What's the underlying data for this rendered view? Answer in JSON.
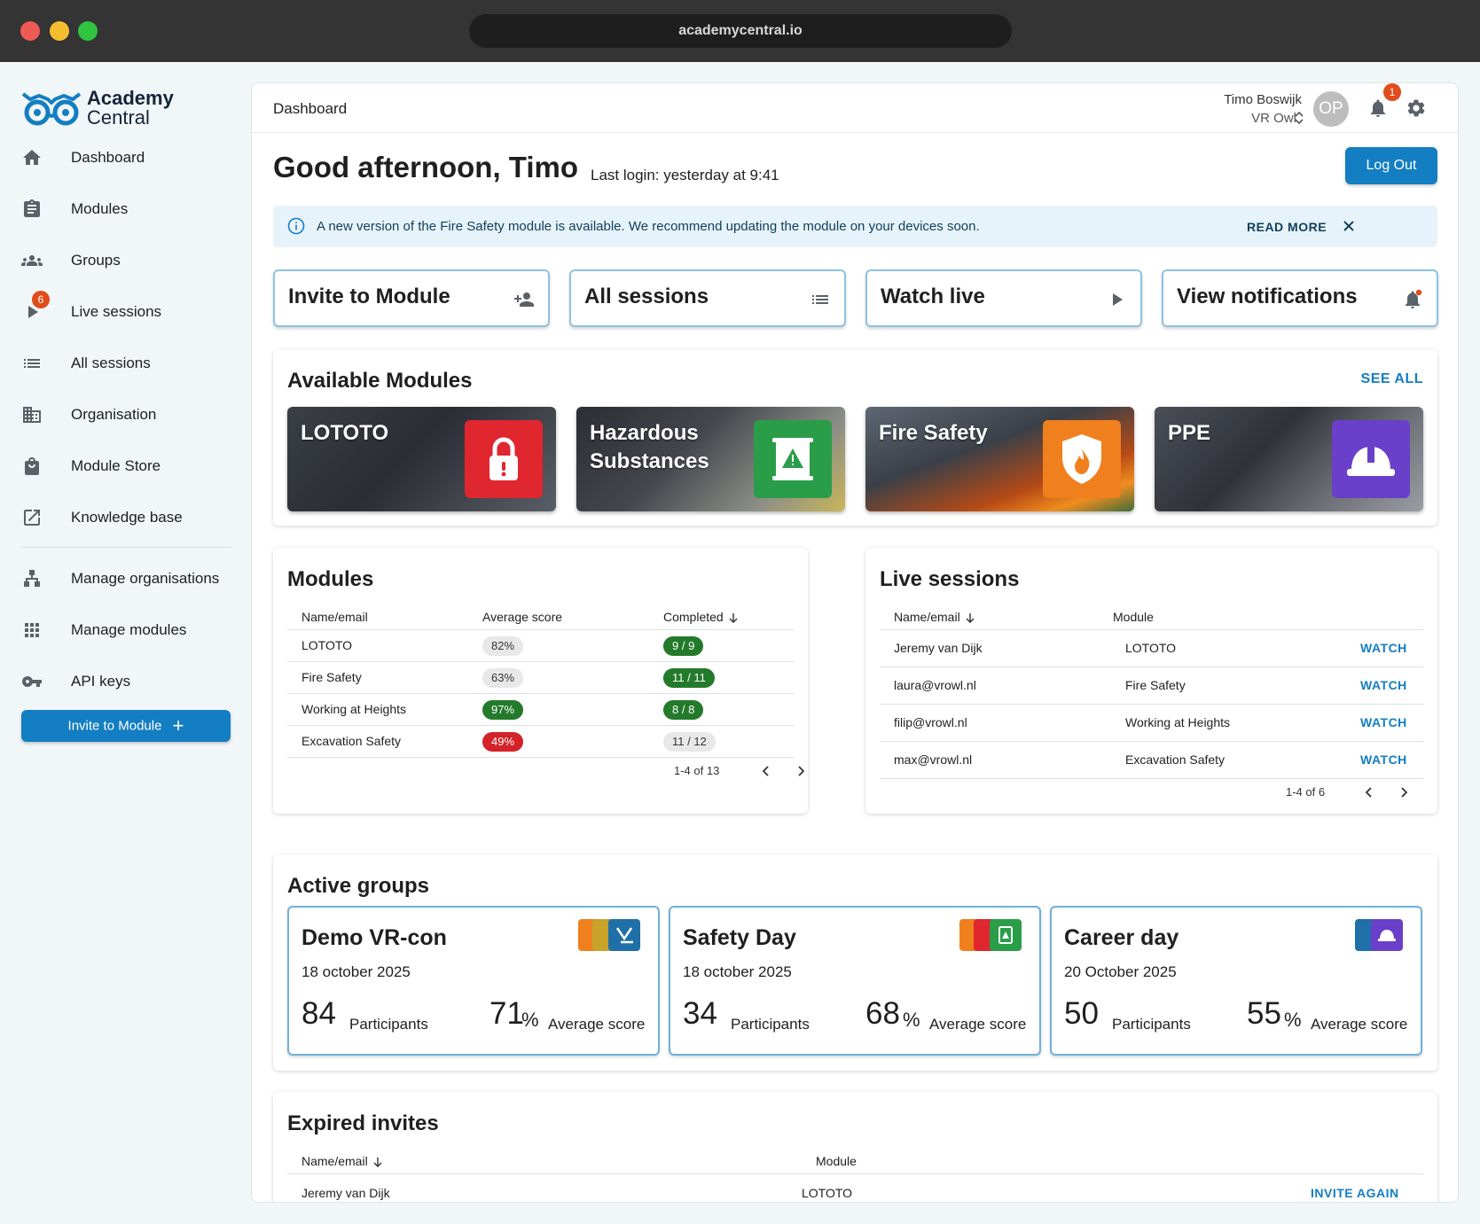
{
  "browser": {
    "url": "academycentral.io"
  },
  "brand": {
    "line1": "Academy",
    "line2": "Central"
  },
  "sidebar": {
    "items": [
      {
        "label": "Dashboard",
        "icon": "home-icon"
      },
      {
        "label": "Modules",
        "icon": "clipboard-icon"
      },
      {
        "label": "Groups",
        "icon": "groups-icon"
      },
      {
        "label": "Live sessions",
        "icon": "play-icon",
        "badge": "6"
      },
      {
        "label": "All sessions",
        "icon": "list-icon"
      },
      {
        "label": "Organisation",
        "icon": "building-icon"
      },
      {
        "label": "Module Store",
        "icon": "shopping-bag-icon"
      },
      {
        "label": "Knowledge base",
        "icon": "external-link-icon"
      },
      {
        "label": "Manage organisations",
        "icon": "hierarchy-icon"
      },
      {
        "label": "Manage modules",
        "icon": "apps-grid-icon"
      },
      {
        "label": "API keys",
        "icon": "key-icon"
      }
    ],
    "invite_label": "Invite to Module",
    "invite_icon": "+"
  },
  "header": {
    "breadcrumb": "Dashboard",
    "user_name": "Timo Boswijk",
    "user_org": "VR Owl",
    "avatar_initials": "OP",
    "notification_count": "1"
  },
  "main": {
    "greeting": "Good afternoon, Timo",
    "last_login": "Last login: yesterday at 9:41",
    "logout_label": "Log Out",
    "alert": {
      "text": "A new version of the Fire Safety module is available. We recommend updating the module on your devices soon.",
      "action": "READ MORE"
    },
    "quick_actions": [
      {
        "label": "Invite to Module",
        "icon": "person-add-icon"
      },
      {
        "label": "All sessions",
        "icon": "list-icon"
      },
      {
        "label": "Watch live",
        "icon": "play-icon"
      },
      {
        "label": "View notifications",
        "icon": "bell-dot-icon"
      }
    ],
    "available_modules": {
      "title": "Available Modules",
      "see_all": "SEE ALL",
      "items": [
        {
          "name": "LOTOTO",
          "icon": "lock-icon",
          "color": "#e0262f"
        },
        {
          "name": "Hazardous Substances",
          "icon": "hazard-barrel-icon",
          "color": "#2a9d48"
        },
        {
          "name": "Fire Safety",
          "icon": "fire-shield-icon",
          "color": "#f07f1e"
        },
        {
          "name": "PPE",
          "icon": "hardhat-icon",
          "color": "#6a3fc9"
        }
      ]
    },
    "modules_table": {
      "title": "Modules",
      "columns": [
        "Name/email",
        "Average score",
        "Completed"
      ],
      "rows": [
        {
          "name": "LOTOTO",
          "score": "82%",
          "score_style": "grey",
          "completed": "9 / 9",
          "completed_style": "green"
        },
        {
          "name": "Fire Safety",
          "score": "63%",
          "score_style": "grey",
          "completed": "11 / 11",
          "completed_style": "green"
        },
        {
          "name": "Working at Heights",
          "score": "97%",
          "score_style": "green",
          "completed": "8 / 8",
          "completed_style": "green"
        },
        {
          "name": "Excavation Safety",
          "score": "49%",
          "score_style": "red",
          "completed": "11 / 12",
          "completed_style": "grey"
        }
      ],
      "pagination": "1-4 of 13"
    },
    "live_sessions": {
      "title": "Live sessions",
      "columns": [
        "Name/email",
        "Module"
      ],
      "rows": [
        {
          "name": "Jeremy van Dijk",
          "module": "LOTOTO",
          "action": "WATCH"
        },
        {
          "name": "laura@vrowl.nl",
          "module": "Fire Safety",
          "action": "WATCH"
        },
        {
          "name": "filip@vrowl.nl",
          "module": "Working at Heights",
          "action": "WATCH"
        },
        {
          "name": "max@vrowl.nl",
          "module": "Excavation Safety",
          "action": "WATCH"
        }
      ],
      "pagination": "1-4 of 6"
    },
    "active_groups": {
      "title": "Active groups",
      "groups": [
        {
          "name": "Demo VR-con",
          "date": "18 october 2025",
          "participants": "84",
          "participants_label": "Participants",
          "score": "71",
          "score_unit": "%",
          "score_label": "Average score"
        },
        {
          "name": "Safety Day",
          "date": "18 october 2025",
          "participants": "34",
          "participants_label": "Participants",
          "score": "68",
          "score_unit": "%",
          "score_label": "Average score"
        },
        {
          "name": "Career day",
          "date": "20 October 2025",
          "participants": "50",
          "participants_label": "Participants",
          "score": "55",
          "score_unit": "%",
          "score_label": "Average score"
        }
      ]
    },
    "expired_invites": {
      "title": "Expired invites",
      "columns": [
        "Name/email",
        "Module"
      ],
      "rows": [
        {
          "name": "Jeremy van Dijk",
          "module": "LOTOTO",
          "action": "INVITE AGAIN"
        }
      ]
    }
  }
}
